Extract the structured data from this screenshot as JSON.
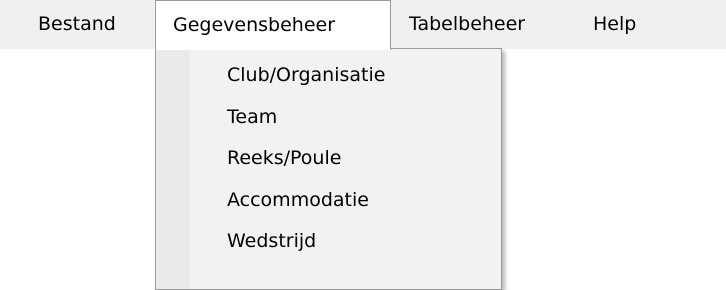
{
  "menubar": {
    "items": [
      {
        "label": "Bestand"
      },
      {
        "label": "Gegevensbeheer"
      },
      {
        "label": "Tabelbeheer"
      },
      {
        "label": "Help"
      }
    ]
  },
  "dropdown": {
    "items": [
      {
        "label": "Club/Organisatie"
      },
      {
        "label": "Team"
      },
      {
        "label": "Reeks/Poule"
      },
      {
        "label": "Accommodatie"
      },
      {
        "label": "Wedstrijd"
      }
    ]
  }
}
